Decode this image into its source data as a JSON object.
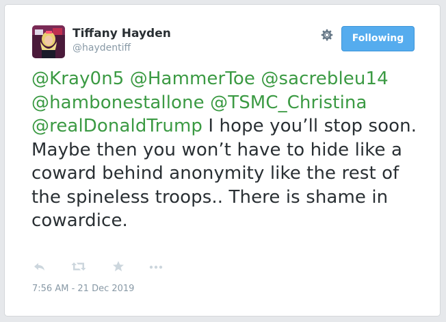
{
  "user": {
    "name": "Tiffany Hayden",
    "handle": "@haydentiff"
  },
  "follow_button": {
    "label": "Following"
  },
  "tweet": {
    "mentions": [
      "@Kray0n5",
      "@HammerToe",
      "@sacrebleu14",
      "@hambonestallone",
      "@TSMC_Christina",
      "@realDonaldTrump"
    ],
    "body": " I hope you’ll stop soon. Maybe then you won’t have to hide like a coward behind anonymity like the rest of the spineless troops.. There is shame in cowardice.",
    "timestamp": "7:56 AM - 21 Dec 2019"
  },
  "icons": {
    "gear": "gear-icon",
    "reply": "reply-icon",
    "retweet": "retweet-icon",
    "favorite": "star-icon",
    "more": "more-icon"
  },
  "colors": {
    "mention": "#3b9a43",
    "button": "#55acee",
    "text": "#292f33",
    "muted": "#8899a6",
    "icon": "#ccd6dd"
  }
}
